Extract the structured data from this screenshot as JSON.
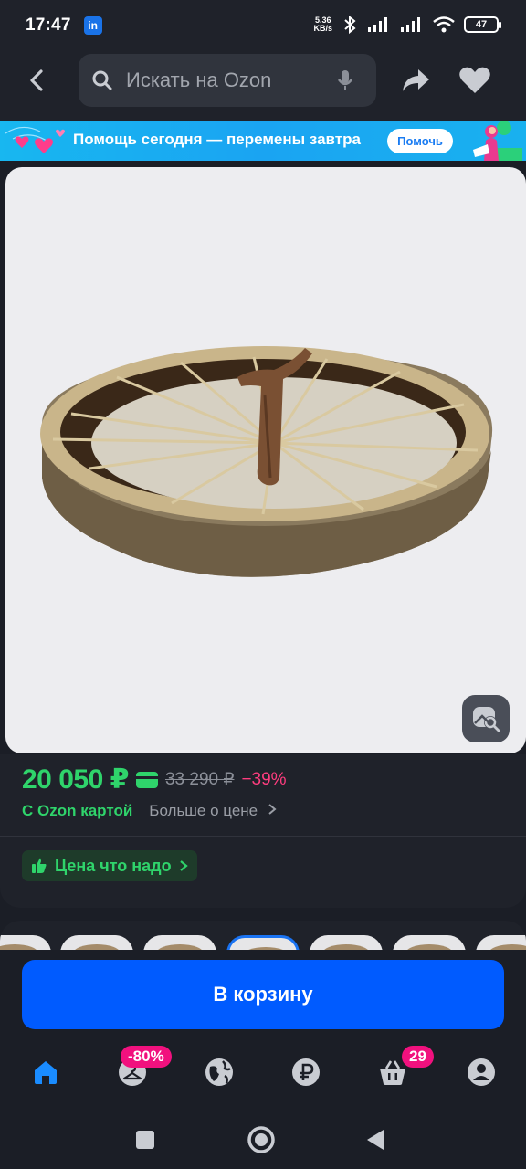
{
  "status_bar": {
    "time": "17:47",
    "linkedin_badge": "in",
    "net_speed_value": "5.36",
    "net_speed_unit": "KB/s",
    "battery": "47"
  },
  "top_nav": {
    "search_placeholder": "Искать на Ozon",
    "icons": [
      "back-icon",
      "search-icon",
      "mic-icon",
      "share-icon",
      "heart-icon"
    ]
  },
  "banner": {
    "text": "Помощь сегодня — перемены завтра",
    "button_label": "Помочь",
    "colors": {
      "background": "#1aa4f2",
      "button_text": "#1a7cf2"
    }
  },
  "product": {
    "image_alt_icon": "image-search-icon",
    "price": "20 050 ₽",
    "old_price": "33 290 ₽",
    "discount": "−39%",
    "ozon_card_label": "С Ozon картой",
    "more_about_price": "Больше о цене",
    "good_price_badge": "Цена что надо",
    "colors": {
      "price": "#2fd46b",
      "discount": "#ff3d7f"
    }
  },
  "cta": {
    "add_to_cart": "В корзину",
    "color": "#005bff"
  },
  "bottom_nav": {
    "items": [
      {
        "name": "home",
        "icon": "home-icon",
        "badge": ""
      },
      {
        "name": "sale",
        "icon": "hanger-icon",
        "badge": "-80%"
      },
      {
        "name": "fresh",
        "icon": "globe-icon",
        "badge": ""
      },
      {
        "name": "finance",
        "icon": "ruble-icon",
        "badge": ""
      },
      {
        "name": "cart",
        "icon": "basket-icon",
        "badge": "29"
      },
      {
        "name": "profile",
        "icon": "profile-icon",
        "badge": ""
      }
    ],
    "badge_color": "#f1117e",
    "active_color": "#1a8cff"
  }
}
